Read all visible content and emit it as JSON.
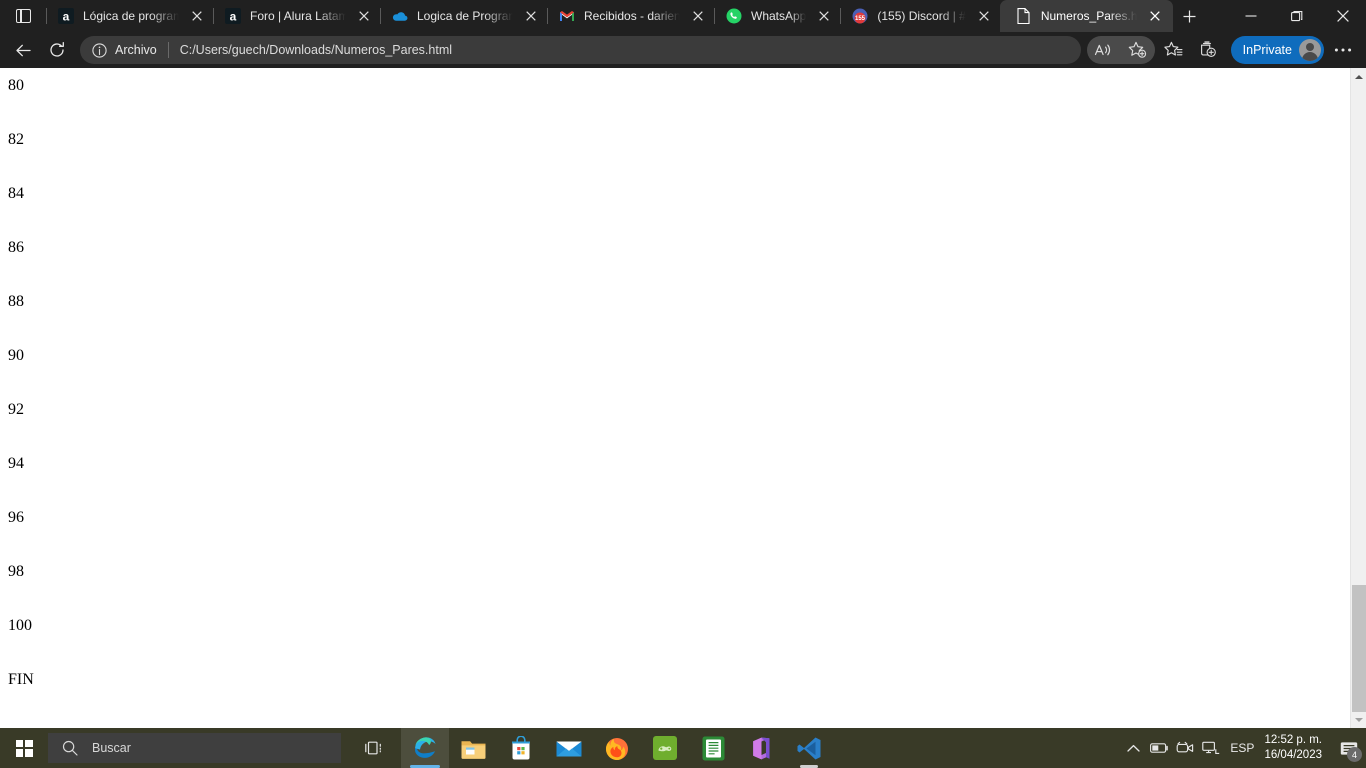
{
  "window": {
    "tab_actions_label": "Tab actions menu",
    "minimize_label": "Minimize",
    "maximize_label": "Restore",
    "close_label": "Close",
    "newtab_label": "New tab"
  },
  "tabs": [
    {
      "title": "Lógica de programa",
      "icon": "alura-icon",
      "active": false
    },
    {
      "title": "Foro | Alura Latam",
      "icon": "alura-icon",
      "active": false
    },
    {
      "title": "Logica de Program",
      "icon": "onedrive-icon",
      "active": false
    },
    {
      "title": "Recibidos - darien",
      "icon": "gmail-icon",
      "active": false
    },
    {
      "title": "WhatsApp",
      "icon": "whatsapp-icon",
      "active": false
    },
    {
      "title": "(155) Discord | #",
      "icon": "discord-icon",
      "active": false
    },
    {
      "title": "Numeros_Pares.ht",
      "icon": "file-icon",
      "active": true
    }
  ],
  "toolbar": {
    "back_label": "Atrás",
    "refresh_label": "Actualizar",
    "info_label": "Información del archivo",
    "url_kind": "Archivo",
    "url": "C:/Users/guech/Downloads/Numeros_Pares.html",
    "read_aloud_label": "Leer en voz alta",
    "add_favorite_label": "Agregar a favoritos",
    "favorites_label": "Favoritos",
    "collections_label": "Colecciones",
    "inprivate_label": "InPrivate",
    "settings_label": "Configuración y más"
  },
  "page": {
    "lines": [
      "80",
      "82",
      "84",
      "86",
      "88",
      "90",
      "92",
      "94",
      "96",
      "98",
      "100",
      "FIN"
    ]
  },
  "scrollbar": {
    "up_label": "Desplazar hacia arriba",
    "down_label": "Desplazar hacia abajo"
  },
  "taskbar": {
    "start_label": "Inicio",
    "search_placeholder": "Buscar",
    "taskview_label": "Vista de tareas",
    "apps": [
      {
        "name": "edge",
        "label": "Microsoft Edge"
      },
      {
        "name": "file-explorer",
        "label": "Explorador de archivos"
      },
      {
        "name": "microsoft-store",
        "label": "Microsoft Store"
      },
      {
        "name": "mail",
        "label": "Correo"
      },
      {
        "name": "firefox",
        "label": "Firefox"
      },
      {
        "name": "green-app",
        "label": "Aplicación"
      },
      {
        "name": "notes-app",
        "label": "Notas"
      },
      {
        "name": "microsoft-365",
        "label": "Microsoft 365"
      },
      {
        "name": "vs-code",
        "label": "Visual Studio Code"
      }
    ],
    "tray": {
      "show_hidden_label": "Mostrar iconos ocultos",
      "battery_label": "Batería",
      "meet_label": "Cámara",
      "network_label": "Red",
      "language": "ESP",
      "time": "12:52 p. m.",
      "date": "16/04/2023",
      "notification_count": "4"
    }
  },
  "colors": {
    "chrome_bg": "#202020",
    "active_tab": "#3b3b3b",
    "omnibox": "#3b3b3b",
    "accent_blue": "#0f6cbd",
    "page_bg": "#ffffff",
    "taskbar": "#393a27",
    "scroll_thumb": "#c2c2c2"
  }
}
